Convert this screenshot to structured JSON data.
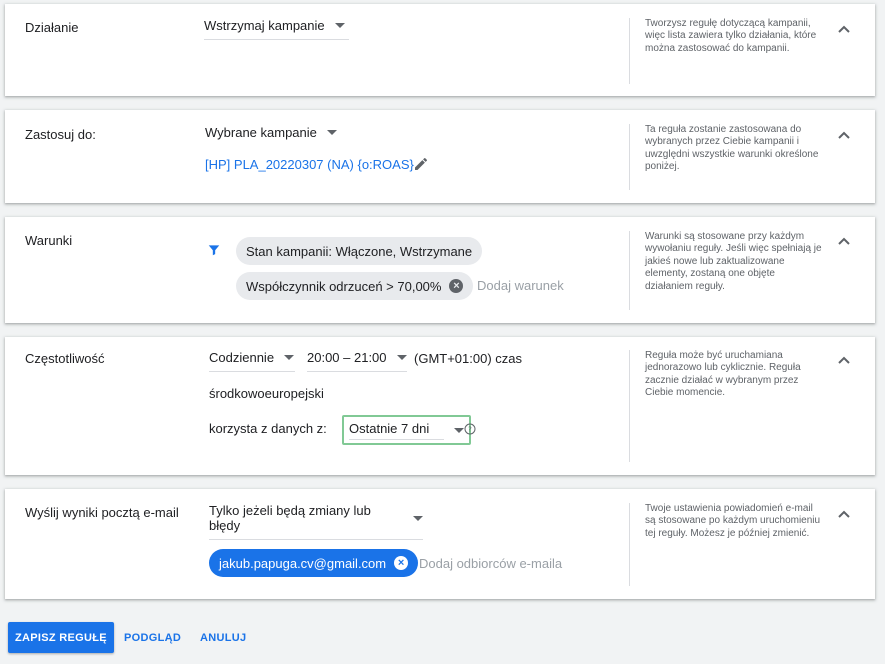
{
  "action": {
    "label": "Działanie",
    "value": "Wstrzymaj kampanie",
    "help": "Tworzysz regułę dotyczącą kampanii, więc lista zawiera tylko działania, które można zastosować do kampanii."
  },
  "apply_to": {
    "label": "Zastosuj do:",
    "value": "Wybrane kampanie",
    "campaign": "[HP] PLA_20220307 (NA) {o:ROAS}",
    "help": "Ta reguła zostanie zastosowana do wybranych przez Ciebie kampanii i uwzględni wszystkie warunki określone poniżej."
  },
  "conditions": {
    "label": "Warunki",
    "chips": [
      "Stan kampanii: Włączone, Wstrzymane",
      "Współczynnik odrzuceń > 70,00%"
    ],
    "add_placeholder": "Dodaj warunek",
    "help": "Warunki są stosowane przy każdym wywołaniu reguły. Jeśli więc spełniają je jakieś nowe lub zaktualizowane elementy, zostaną one objęte działaniem reguły."
  },
  "frequency": {
    "label": "Częstotliwość",
    "value": "Codziennie",
    "time": "20:00 – 21:00",
    "timezone_line1": "(GMT+01:00) czas",
    "timezone_line2": "środkowoeuropejski",
    "data_label": "korzysta z danych z:",
    "data_value": "Ostatnie 7 dni",
    "help": "Reguła może być uruchamiana jednorazowo lub cyklicznie. Reguła zacznie działać w wybranym przez Ciebie momencie."
  },
  "email": {
    "label": "Wyślij wyniki pocztą e-mail",
    "value": "Tylko jeżeli będą zmiany lub błędy",
    "recipient": "jakub.papuga.cv@gmail.com",
    "add_placeholder": "Dodaj odbiorców e-maila",
    "help": "Twoje ustawienia powiadomień e-mail są stosowane po każdym uruchomieniu tej reguły. Możesz je później zmienić."
  },
  "footer": {
    "save": "ZAPISZ REGUŁĘ",
    "preview": "PODGLĄD",
    "cancel": "ANULUJ"
  },
  "colors": {
    "accent": "#1a73e8",
    "focus_border": "#81c995"
  }
}
